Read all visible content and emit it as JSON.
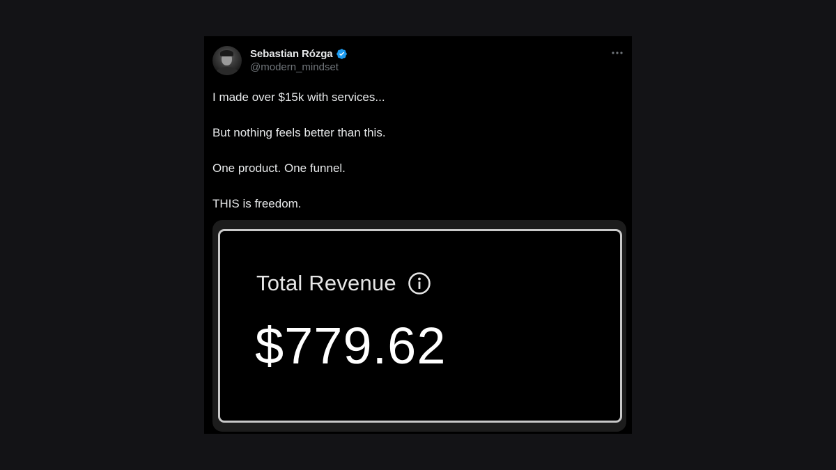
{
  "tweet": {
    "author": {
      "display_name": "Sebastian Rózga",
      "handle": "@modern_mindset",
      "verified": true,
      "verified_color": "#1d9bf0"
    },
    "paragraphs": [
      "I made over $15k with services...",
      "But nothing feels better than this.",
      "One product. One funnel.",
      "THIS is freedom."
    ],
    "media": {
      "label": "Total Revenue",
      "value": "$779.62",
      "icon": "info-icon"
    }
  },
  "colors": {
    "background": "#131316",
    "card": "#000000",
    "text": "#e7e9ea",
    "muted": "#71767b"
  }
}
